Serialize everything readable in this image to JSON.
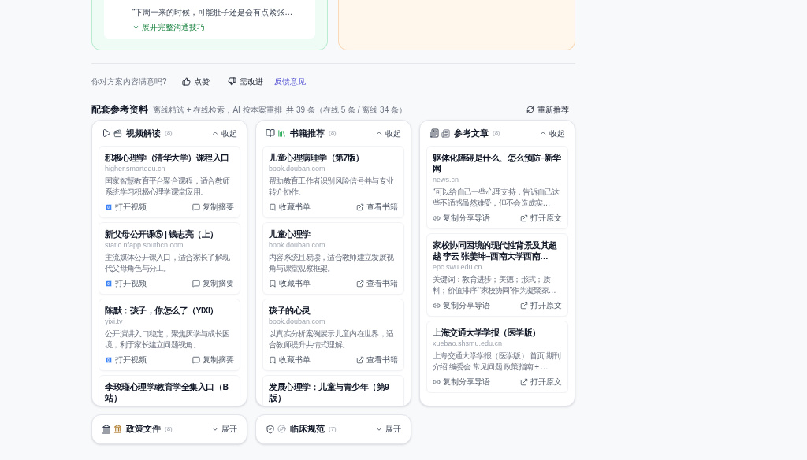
{
  "top_cards": {
    "quote": "“下周一来的时候，可能肚子还是会有点紧张…",
    "expand_link": "展开完整沟通技巧"
  },
  "feedback": {
    "question": "你对方案内容满意吗?",
    "like": "点赞",
    "dislike": "需改进",
    "link": "反馈意见"
  },
  "references": {
    "title": "配套参考资料",
    "subtitle": "离线精选 + 在线检索，AI 按本案重排  共 39 条（在线 5 条 / 离线 34 条）",
    "refresh": "重新推荐"
  },
  "sections": [
    {
      "kind": "video",
      "title": "视频解读",
      "count": "(8)",
      "toggle": "收起",
      "expanded": true,
      "items": [
        {
          "title": "积极心理学（清华大学）课程入口",
          "domain": "higher.smartedu.cn",
          "desc": "国家智慧教育平台聚合课程，适合教师系统学习积极心理学课堂应用。",
          "actions": [
            "打开视频",
            "复制摘要"
          ]
        },
        {
          "title": "新父母公开课⑤ | 钱志亮（上）",
          "domain": "static.nfapp.southcn.com",
          "desc": "主流媒体公开课入口，适合家长了解现代父母角色与分工。",
          "actions": [
            "打开视频",
            "复制摘要"
          ]
        },
        {
          "title": "陈默：孩子，你怎么了（YIXI）",
          "domain": "yixi.tv",
          "desc": "公开演讲入口稳定，聚焦厌学与成长困境，利于家长建立问题视角。",
          "actions": [
            "打开视频",
            "复制摘要"
          ]
        },
        {
          "title": "李玫瑾心理学/教育学全集入口（B站）"
        }
      ]
    },
    {
      "kind": "book",
      "title": "书籍推荐",
      "count": "(8)",
      "toggle": "收起",
      "expanded": true,
      "items": [
        {
          "title": "儿童心理病理学（第7版）",
          "domain": "book.douban.com",
          "desc": "帮助教育工作者识别风险信号并与专业转介协作。",
          "actions": [
            "收藏书单",
            "查看书籍"
          ]
        },
        {
          "title": "儿童心理学",
          "domain": "book.douban.com",
          "desc": "内容系统且易读，适合教师建立发展视角与课堂观察框架。",
          "actions": [
            "收藏书单",
            "查看书籍"
          ]
        },
        {
          "title": "孩子的心灵",
          "domain": "book.douban.com",
          "desc": "以真实分析案例展示儿童内在世界，适合教师提升共情式理解。",
          "actions": [
            "收藏书单",
            "查看书籍"
          ]
        },
        {
          "title": "发展心理学：儿童与青少年（第9版）"
        }
      ]
    },
    {
      "kind": "article",
      "title": "参考文章",
      "count": "(8)",
      "toggle": "收起",
      "expanded": true,
      "items": [
        {
          "title": "躯体化障碍是什么、怎么预防–新华网",
          "domain": "news.cn",
          "desc": "“可以给自己一些心理支持，告诉自己这些不适感虽然难受，但不会造成实…",
          "actions": [
            "复制分享导语",
            "打开原文"
          ]
        },
        {
          "title": "家校协同困境的现代性背景及其超越 李云 张姜坤–西南大学西南…",
          "domain": "epc.swu.edu.cn",
          "desc": "关键词：教育进步；美德；形式；质料；价值排序 “家校协同”作为凝聚家…",
          "actions": [
            "复制分享导语",
            "打开原文"
          ]
        },
        {
          "title": "上海交通大学学报（医学版）",
          "domain": "xuebao.shsmu.edu.cn",
          "desc": "上海交通大学学报（医学版） 首页 期刊介绍 编委会 常见问题 政策指南 + …",
          "actions": [
            "复制分享导语",
            "打开原文"
          ]
        }
      ]
    },
    {
      "kind": "policy",
      "title": "政策文件",
      "count": "(8)",
      "toggle": "展开",
      "expanded": false
    },
    {
      "kind": "clinical",
      "title": "临床规范",
      "count": "(7)",
      "toggle": "展开",
      "expanded": false
    }
  ]
}
